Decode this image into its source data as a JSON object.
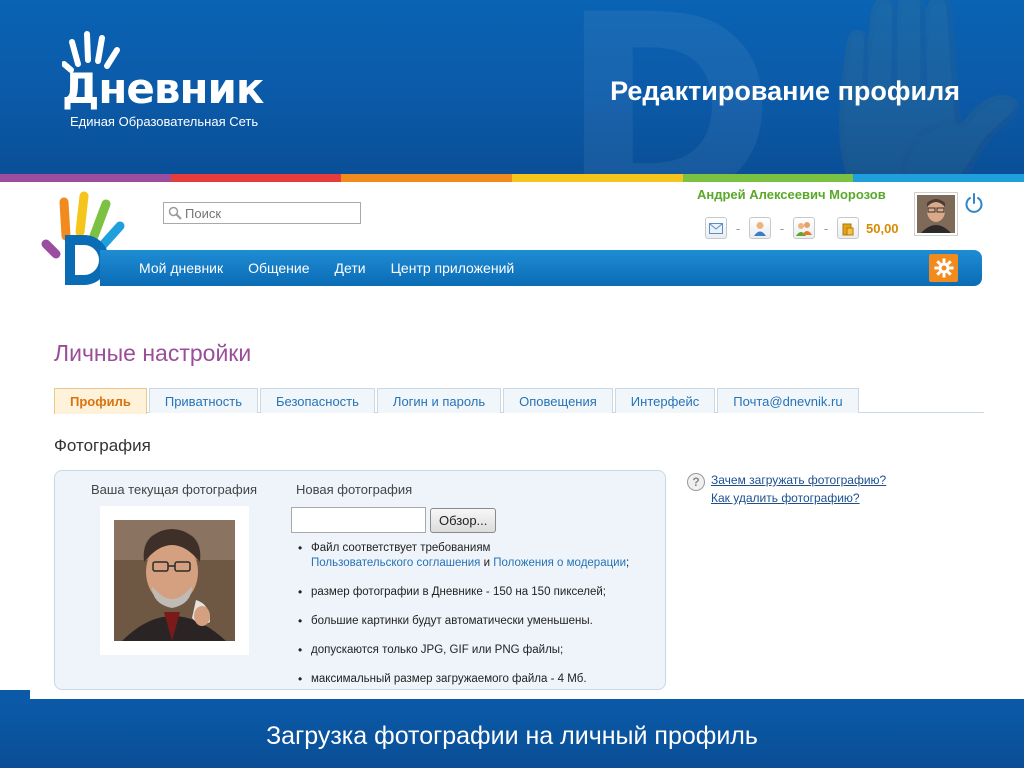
{
  "slide": {
    "logo_word": "Дневник",
    "logo_subtitle": "Единая Образовательная Сеть",
    "title": "Редактирование профиля",
    "caption": "Загрузка фотографии на личный профиль"
  },
  "header": {
    "search_placeholder": "Поиск",
    "user_name": "Андрей Алексеевич Морозов",
    "balance": "50,00",
    "user_icons": [
      "mail-icon",
      "person-icon",
      "friends-icon",
      "coins-icon"
    ]
  },
  "nav": {
    "items": [
      "Мой дневник",
      "Общение",
      "Дети",
      "Центр приложений"
    ]
  },
  "page": {
    "title": "Личные настройки",
    "tabs": [
      "Профиль",
      "Приватность",
      "Безопасность",
      "Логин и пароль",
      "Оповещения",
      "Интерфейс",
      "Почта@dnevnik.ru"
    ],
    "active_tab": "Профиль",
    "section_title": "Фотография"
  },
  "photo": {
    "current_label": "Ваша текущая фотография",
    "new_label": "Новая фотография",
    "browse_button": "Обзор...",
    "rule1_text": "Файл соответствует требованиям",
    "rule1_link1": "Пользовательского соглашения",
    "rule1_and": " и ",
    "rule1_link2": "Положения о модерации",
    "rule1_end": ";",
    "rule2": "размер фотографии в Дневнике - 150 на 150 пикселей;",
    "rule3": "большие картинки будут автоматически уменьшены.",
    "rule4": "допускаются только JPG, GIF или PNG файлы;",
    "rule5": "максимальный размер загружаемого файла - 4 Мб."
  },
  "help": {
    "link1": "Зачем загружать фотографию?",
    "link2": "Как удалить фотографию?"
  },
  "colors": {
    "brand_blue": "#0b5aa8",
    "title_purple": "#9a4e9a",
    "user_green": "#5aa82a",
    "balance_orange": "#d88a00",
    "rainbow": [
      "#9b4ea0",
      "#e63c3c",
      "#f28b1e",
      "#f6c51c",
      "#7cc242",
      "#1fa0dc"
    ]
  }
}
